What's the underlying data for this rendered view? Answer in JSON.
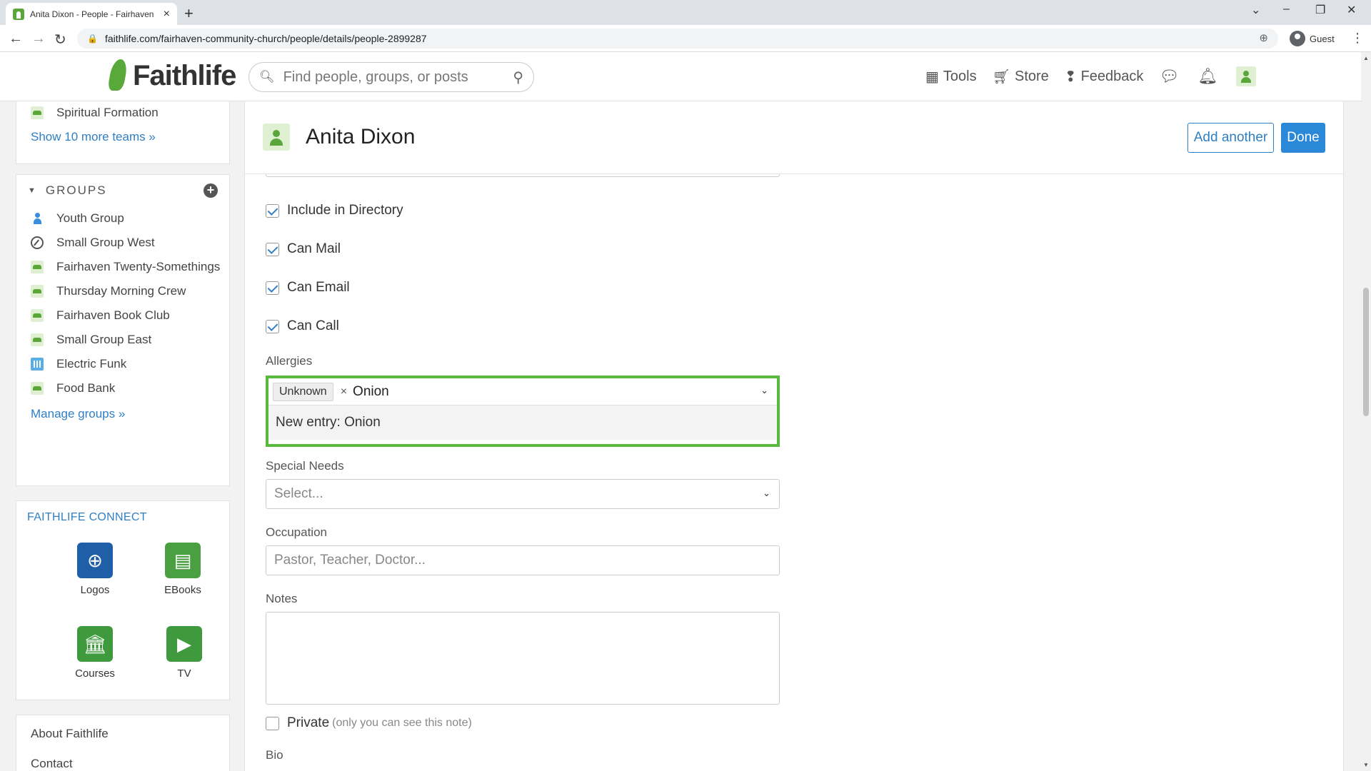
{
  "browser": {
    "tab_title": "Anita Dixon - People - Fairhaven",
    "url": "faithlife.com/fairhaven-community-church/people/details/people-2899287",
    "profile_label": "Guest"
  },
  "header": {
    "logo_text": "Faithlife",
    "search_placeholder": "Find people, groups, or posts",
    "nav": {
      "tools": "Tools",
      "store": "Store",
      "feedback": "Feedback"
    }
  },
  "sidebar": {
    "teams_last_item": "Spiritual Formation",
    "show_more_teams": "Show 10 more teams »",
    "groups_heading": "GROUPS",
    "groups": [
      {
        "label": "Youth Group",
        "icon": "person-icon"
      },
      {
        "label": "Small Group West",
        "icon": "compass-icon"
      },
      {
        "label": "Fairhaven Twenty-Somethings",
        "icon": "group-icon"
      },
      {
        "label": "Thursday Morning Crew",
        "icon": "group-icon"
      },
      {
        "label": "Fairhaven Book Club",
        "icon": "group-icon"
      },
      {
        "label": "Small Group East",
        "icon": "group-icon"
      },
      {
        "label": "Electric Funk",
        "icon": "bars-icon"
      },
      {
        "label": "Food Bank",
        "icon": "group-icon"
      }
    ],
    "manage_groups": "Manage groups »",
    "connect_heading": "FAITHLIFE CONNECT",
    "apps": [
      {
        "label": "Logos",
        "color": "#1f5fa8"
      },
      {
        "label": "EBooks",
        "color": "#4aa040"
      },
      {
        "label": "Courses",
        "color": "#3e9a3c"
      },
      {
        "label": "TV",
        "color": "#3e9a3c"
      }
    ],
    "footer_links": [
      "About Faithlife",
      "Contact"
    ]
  },
  "person": {
    "name": "Anita Dixon",
    "add_another": "Add another",
    "done": "Done"
  },
  "form": {
    "cut_placeholder": "Select...",
    "checkboxes": [
      {
        "label": "Include in Directory",
        "checked": true
      },
      {
        "label": "Can Mail",
        "checked": true
      },
      {
        "label": "Can Email",
        "checked": true
      },
      {
        "label": "Can Call",
        "checked": true
      }
    ],
    "allergies_label": "Allergies",
    "allergies_chip": "Unknown",
    "allergies_typed": "Onion",
    "allergies_option": "New entry: Onion",
    "special_needs_label": "Special Needs",
    "special_needs_placeholder": "Select...",
    "occupation_label": "Occupation",
    "occupation_placeholder": "Pastor, Teacher, Doctor...",
    "notes_label": "Notes",
    "private_label": "Private",
    "private_note": "(only you can see this note)",
    "bio_label": "Bio"
  },
  "colors": {
    "brand_green": "#5ba63a",
    "link_blue": "#2f7fc4",
    "focus_green": "#5aba3c",
    "primary_button": "#2b88d8"
  }
}
